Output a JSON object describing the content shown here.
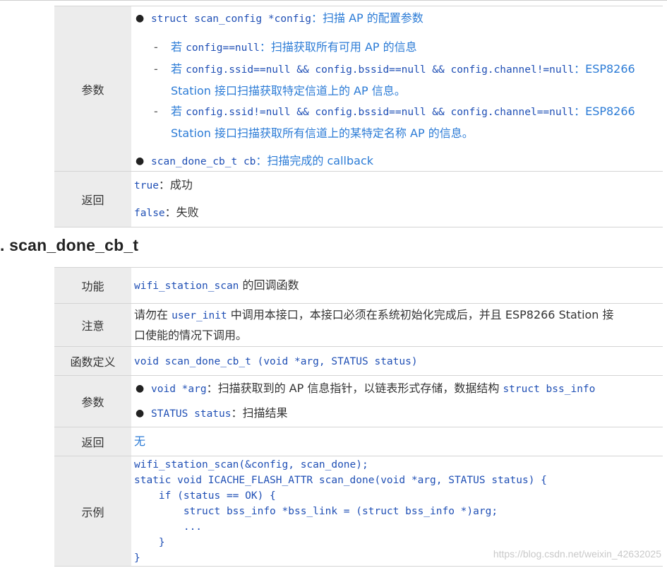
{
  "params_table": {
    "label": "参数",
    "bullet1_code": "struct scan_config *config",
    "bullet1_text": "：扫描 AP 的配置参数",
    "sub1_prefix": "若 ",
    "sub1_code": "config==null",
    "sub1_text": "：扫描获取所有可用 AP 的信息",
    "sub2_prefix": "若 ",
    "sub2_code": "config.ssid==null && config.bssid==null && config.channel!=null",
    "sub2_text_a": "：ESP8266",
    "sub2_text_b": "Station 接口扫描获取特定信道上的 AP 信息。",
    "sub3_prefix": "若 ",
    "sub3_code": "config.ssid!=null && config.bssid==null && config.channel==null",
    "sub3_text_a": "：ESP8266",
    "sub3_text_b": "Station 接口扫描获取所有信道上的某特定名称 AP 的信息。",
    "bullet2_code": "scan_done_cb_t cb",
    "bullet2_text": "：扫描完成的 callback"
  },
  "return_row": {
    "label": "返回",
    "line1_code": "true",
    "line1_text": "：成功",
    "line2_code": "false",
    "line2_text": "：失败"
  },
  "section": {
    "title": ". scan_done_cb_t"
  },
  "cb_table": {
    "func_label": "功能",
    "func_code": "wifi_station_scan",
    "func_text": " 的回调函数",
    "note_label": "注意",
    "note_prefix": "请勿在 ",
    "note_code": "user_init",
    "note_text_a": " 中调用本接口，本接口必须在系统初始化完成后，并且 ESP8266 Station 接",
    "note_text_b": "口使能的情况下调用。",
    "def_label": "函数定义",
    "def_code": "void scan_done_cb_t (void *arg, STATUS status)",
    "param_label": "参数",
    "param1_code": "void *arg",
    "param1_text": "：扫描获取到的 AP 信息指针，以链表形式存储，数据结构 ",
    "param1_code2": "struct bss_info",
    "param2_code": "STATUS status",
    "param2_text": "：扫描结果",
    "ret_label": "返回",
    "ret_text": "无",
    "example_label": "示例",
    "example_code": "wifi_station_scan(&config, scan_done);\nstatic void ICACHE_FLASH_ATTR scan_done(void *arg, STATUS status) {\n    if (status == OK) {\n        struct bss_info *bss_link = (struct bss_info *)arg;\n        ...\n    }\n}"
  },
  "watermark": "https://blog.csdn.net/weixin_42632025",
  "colors": {
    "label_bg": "#ececec",
    "link_blue": "#2b7bd6",
    "code_blue": "#1f4fb5",
    "border": "#d4d4d4"
  }
}
